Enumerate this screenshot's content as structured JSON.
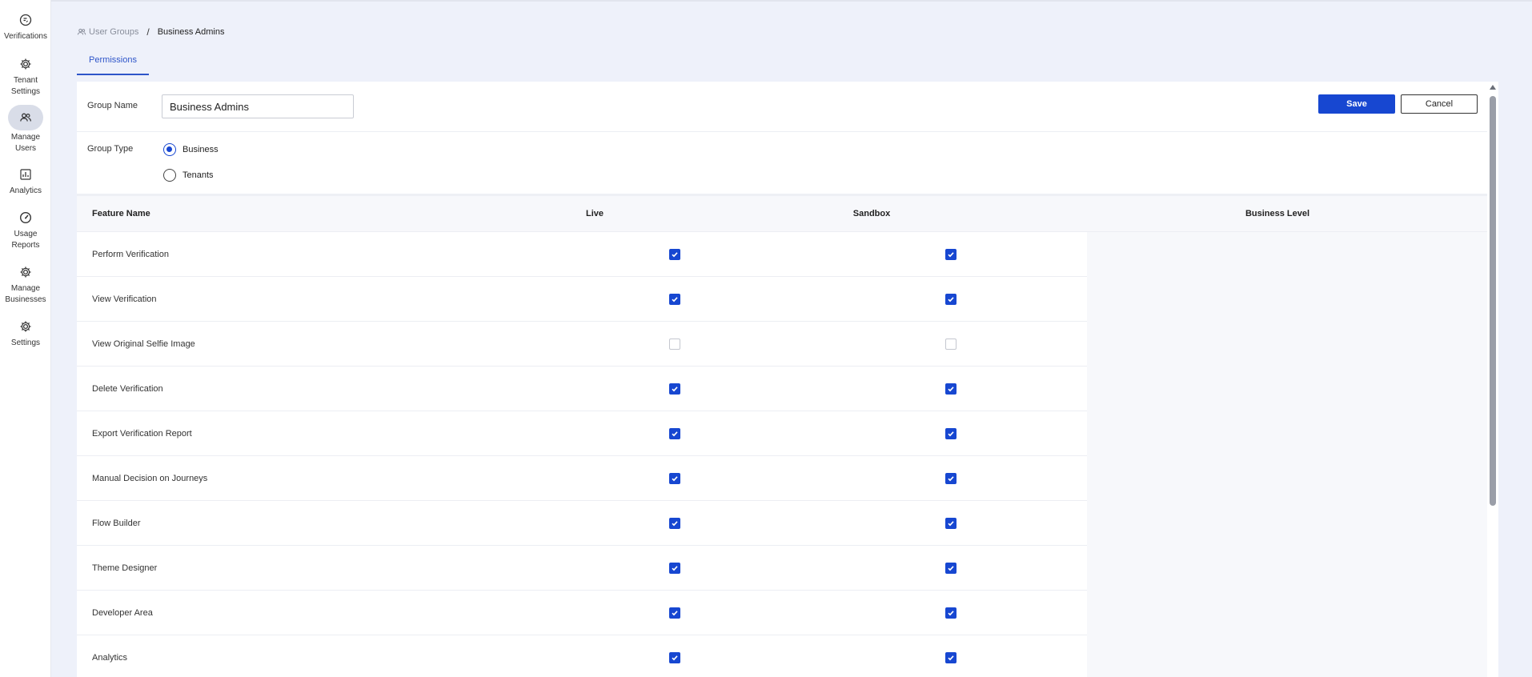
{
  "sidebar": {
    "items": [
      {
        "label": "Verifications",
        "icon": "verifications-icon"
      },
      {
        "label": "Tenant Settings",
        "icon": "gear-icon"
      },
      {
        "label": "Manage Users",
        "icon": "users-icon",
        "active": true
      },
      {
        "label": "Analytics",
        "icon": "analytics-icon"
      },
      {
        "label": "Usage Reports",
        "icon": "speedometer-icon"
      },
      {
        "label": "Manage Businesses",
        "icon": "gear-icon"
      },
      {
        "label": "Settings",
        "icon": "gear-icon"
      }
    ]
  },
  "breadcrumb": {
    "parent": "User Groups",
    "separator": "/",
    "current": "Business Admins"
  },
  "tabs": [
    {
      "label": "Permissions",
      "active": true
    }
  ],
  "form": {
    "group_name_label": "Group Name",
    "group_name_value": "Business Admins",
    "group_type_label": "Group Type",
    "group_type_options": [
      {
        "label": "Business",
        "checked": true
      },
      {
        "label": "Tenants",
        "checked": false
      }
    ],
    "save_label": "Save",
    "cancel_label": "Cancel"
  },
  "table": {
    "headers": {
      "feature": "Feature Name",
      "live": "Live",
      "sandbox": "Sandbox",
      "business": "Business Level"
    },
    "rows": [
      {
        "feature": "Perform Verification",
        "live": true,
        "sandbox": true
      },
      {
        "feature": "View Verification",
        "live": true,
        "sandbox": true
      },
      {
        "feature": "View Original Selfie Image",
        "live": false,
        "sandbox": false
      },
      {
        "feature": "Delete Verification",
        "live": true,
        "sandbox": true
      },
      {
        "feature": "Export Verification Report",
        "live": true,
        "sandbox": true
      },
      {
        "feature": "Manual Decision on Journeys",
        "live": true,
        "sandbox": true
      },
      {
        "feature": "Flow Builder",
        "live": true,
        "sandbox": true
      },
      {
        "feature": "Theme Designer",
        "live": true,
        "sandbox": true
      },
      {
        "feature": "Developer Area",
        "live": true,
        "sandbox": true
      },
      {
        "feature": "Analytics",
        "live": true,
        "sandbox": true
      }
    ]
  },
  "colors": {
    "accent": "#1747d1",
    "background": "#eef1fa",
    "tab_active": "#2e55c9"
  }
}
